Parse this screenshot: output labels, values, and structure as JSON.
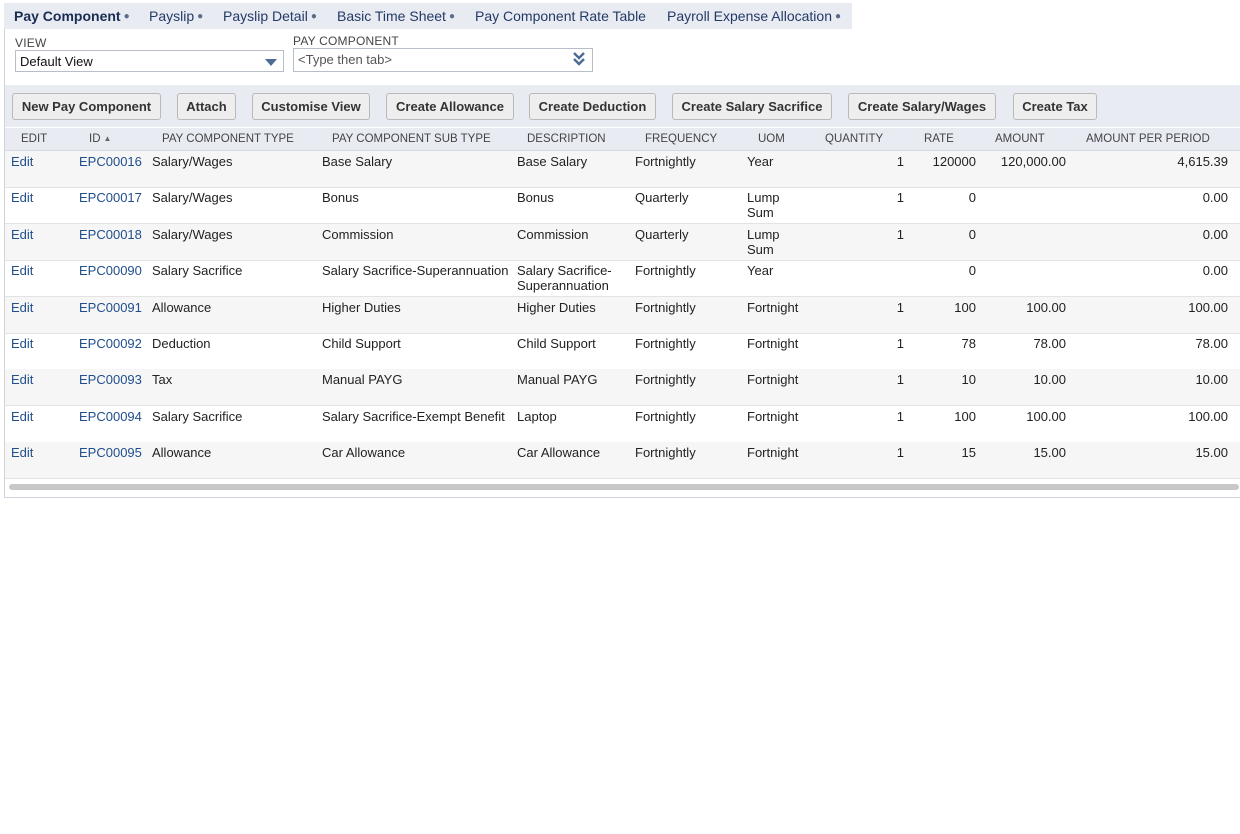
{
  "tabs": [
    {
      "label": "Pay Component",
      "dot": true,
      "active": true
    },
    {
      "label": "Payslip",
      "dot": true,
      "active": false
    },
    {
      "label": "Payslip Detail",
      "dot": true,
      "active": false
    },
    {
      "label": "Basic Time Sheet",
      "dot": true,
      "active": false
    },
    {
      "label": "Pay Component Rate Table",
      "dot": false,
      "active": false
    },
    {
      "label": "Payroll Expense Allocation",
      "dot": true,
      "active": false
    }
  ],
  "filters": {
    "view_label": "VIEW",
    "view_value": "Default View",
    "pay_component_label": "PAY COMPONENT",
    "pay_component_placeholder": "<Type then tab>"
  },
  "buttons": {
    "new_pay_component": "New Pay Component",
    "attach": "Attach",
    "customise_view": "Customise View",
    "create_allowance": "Create Allowance",
    "create_deduction": "Create Deduction",
    "create_salary_sacrifice": "Create Salary Sacrifice",
    "create_salary_wages": "Create Salary/Wages",
    "create_tax": "Create Tax"
  },
  "table": {
    "columns": {
      "edit": "EDIT",
      "id": "ID",
      "type": "PAY COMPONENT TYPE",
      "sub_type": "PAY COMPONENT SUB TYPE",
      "description": "DESCRIPTION",
      "frequency": "FREQUENCY",
      "uom": "UOM",
      "quantity": "QUANTITY",
      "rate": "RATE",
      "amount": "AMOUNT",
      "amount_per_period": "AMOUNT PER PERIOD"
    },
    "sort_indicator": "▲",
    "rows": [
      {
        "edit": "Edit",
        "id": "EPC00016",
        "type": "Salary/Wages",
        "sub_type": "Base Salary",
        "description": "Base Salary",
        "frequency": "Fortnightly",
        "uom": "Year",
        "quantity": "1",
        "rate": "120000",
        "amount": "120,000.00",
        "amount_per_period": "4,615.39"
      },
      {
        "edit": "Edit",
        "id": "EPC00017",
        "type": "Salary/Wages",
        "sub_type": "Bonus",
        "description": "Bonus",
        "frequency": "Quarterly",
        "uom": "Lump Sum",
        "quantity": "1",
        "rate": "0",
        "amount": "",
        "amount_per_period": "0.00"
      },
      {
        "edit": "Edit",
        "id": "EPC00018",
        "type": "Salary/Wages",
        "sub_type": "Commission",
        "description": "Commission",
        "frequency": "Quarterly",
        "uom": "Lump Sum",
        "quantity": "1",
        "rate": "0",
        "amount": "",
        "amount_per_period": "0.00"
      },
      {
        "edit": "Edit",
        "id": "EPC00090",
        "type": "Salary Sacrifice",
        "sub_type": "Salary Sacrifice-Superannuation",
        "description": "Salary Sacrifice-Superannuation",
        "frequency": "Fortnightly",
        "uom": "Year",
        "quantity": "",
        "rate": "0",
        "amount": "",
        "amount_per_period": "0.00"
      },
      {
        "edit": "Edit",
        "id": "EPC00091",
        "type": "Allowance",
        "sub_type": "Higher Duties",
        "description": "Higher Duties",
        "frequency": "Fortnightly",
        "uom": "Fortnight",
        "quantity": "1",
        "rate": "100",
        "amount": "100.00",
        "amount_per_period": "100.00"
      },
      {
        "edit": "Edit",
        "id": "EPC00092",
        "type": "Deduction",
        "sub_type": "Child Support",
        "description": "Child Support",
        "frequency": "Fortnightly",
        "uom": "Fortnight",
        "quantity": "1",
        "rate": "78",
        "amount": "78.00",
        "amount_per_period": "78.00"
      },
      {
        "edit": "Edit",
        "id": "EPC00093",
        "type": "Tax",
        "sub_type": "Manual PAYG",
        "description": "Manual PAYG",
        "frequency": "Fortnightly",
        "uom": "Fortnight",
        "quantity": "1",
        "rate": "10",
        "amount": "10.00",
        "amount_per_period": "10.00"
      },
      {
        "edit": "Edit",
        "id": "EPC00094",
        "type": "Salary Sacrifice",
        "sub_type": "Salary Sacrifice-Exempt Benefit",
        "description": "Laptop",
        "frequency": "Fortnightly",
        "uom": "Fortnight",
        "quantity": "1",
        "rate": "100",
        "amount": "100.00",
        "amount_per_period": "100.00"
      },
      {
        "edit": "Edit",
        "id": "EPC00095",
        "type": "Allowance",
        "sub_type": "Car Allowance",
        "description": "Car Allowance",
        "frequency": "Fortnightly",
        "uom": "Fortnight",
        "quantity": "1",
        "rate": "15",
        "amount": "15.00",
        "amount_per_period": "15.00"
      }
    ]
  }
}
